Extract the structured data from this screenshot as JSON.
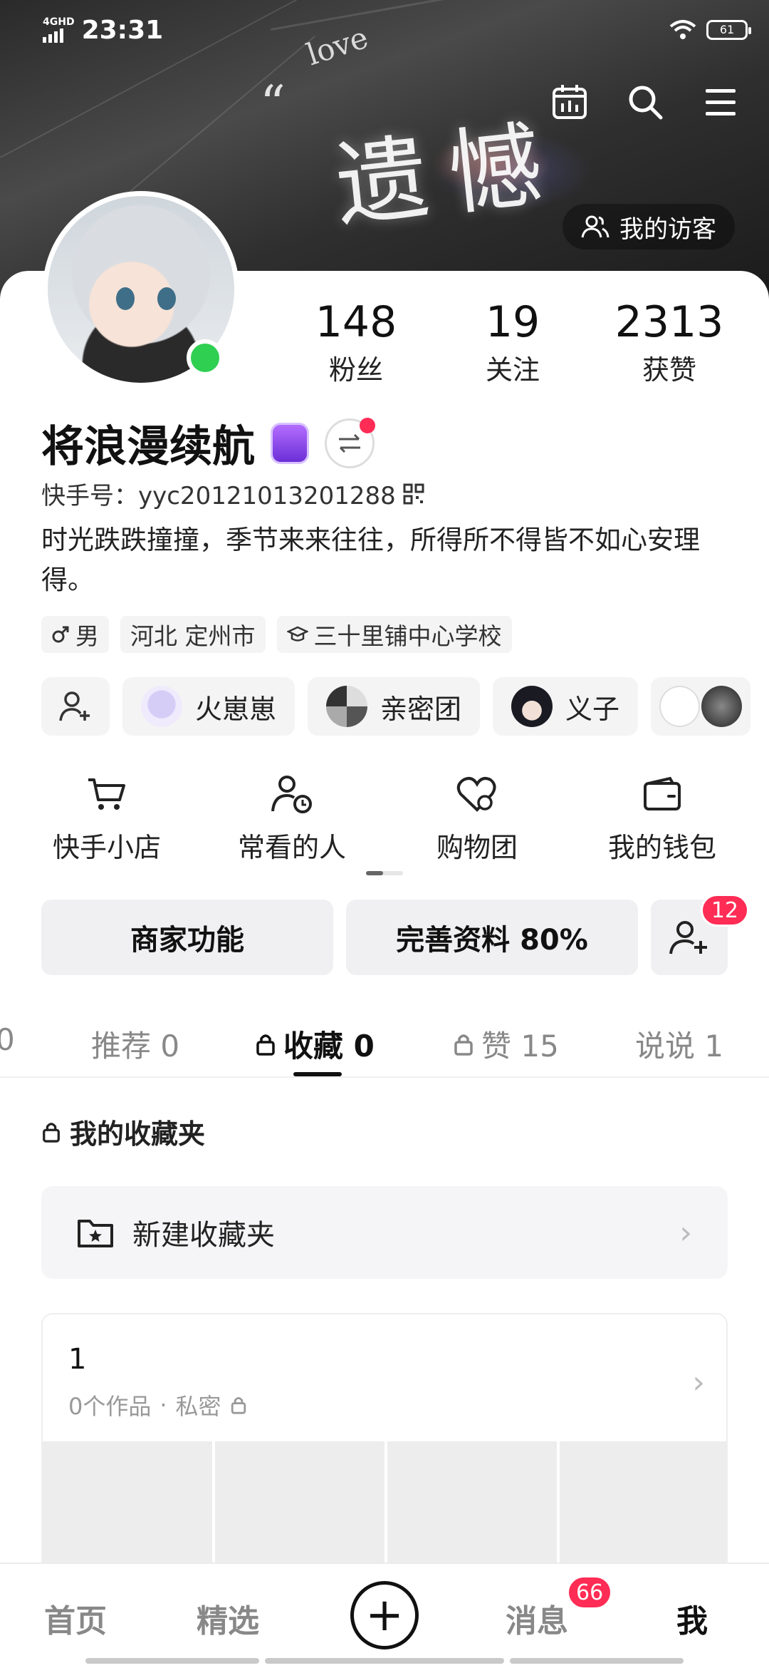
{
  "status_bar": {
    "network": "4GHD",
    "time": "23:31",
    "battery": "61"
  },
  "header": {
    "banner_text": "遗憾",
    "banner_decor": "love",
    "banner_quote": "“",
    "visitors_label": "我的访客"
  },
  "profile": {
    "stats": [
      {
        "value": "148",
        "label": "粉丝"
      },
      {
        "value": "19",
        "label": "关注"
      },
      {
        "value": "2313",
        "label": "获赞"
      }
    ],
    "name": "将浪漫续航",
    "kuaishou_id": "快手号：yyc20121013201288",
    "bio": "时光跌跌撞撞，季节来来往往，所得所不得皆不如心安理得。",
    "tags": [
      {
        "icon": "male-icon",
        "label": "男"
      },
      {
        "icon": "",
        "label": "河北 定州市"
      },
      {
        "icon": "school-icon",
        "label": "三十里铺中心学校"
      }
    ],
    "friends": [
      "火崽崽",
      "亲密团",
      "义子"
    ]
  },
  "shortcuts": [
    {
      "icon": "cart-icon",
      "label": "快手小店"
    },
    {
      "icon": "person-clock-icon",
      "label": "常看的人"
    },
    {
      "icon": "heart-shop-icon",
      "label": "购物团"
    },
    {
      "icon": "wallet-icon",
      "label": "我的钱包"
    }
  ],
  "actions": {
    "merchant": "商家功能",
    "complete_profile": "完善资料 80%",
    "friend_requests": "12"
  },
  "tabs": [
    {
      "label": "0",
      "locked": false
    },
    {
      "label": "推荐 0",
      "locked": false
    },
    {
      "label": "收藏 0",
      "locked": true,
      "active": true
    },
    {
      "label": "赞 15",
      "locked": true
    },
    {
      "label": "说说 1",
      "locked": false
    }
  ],
  "favorites": {
    "section_title": "我的收藏夹",
    "new_folder": "新建收藏夹",
    "folder": {
      "title": "1",
      "works": "0个作品",
      "separator": "·",
      "privacy": "私密"
    }
  },
  "bottom_nav": {
    "home": "首页",
    "featured": "精选",
    "messages": "消息",
    "messages_badge": "66",
    "me": "我"
  },
  "colors": {
    "accent": "#ff2c55",
    "online": "#2fcf52",
    "badge": "#8a4af0"
  }
}
